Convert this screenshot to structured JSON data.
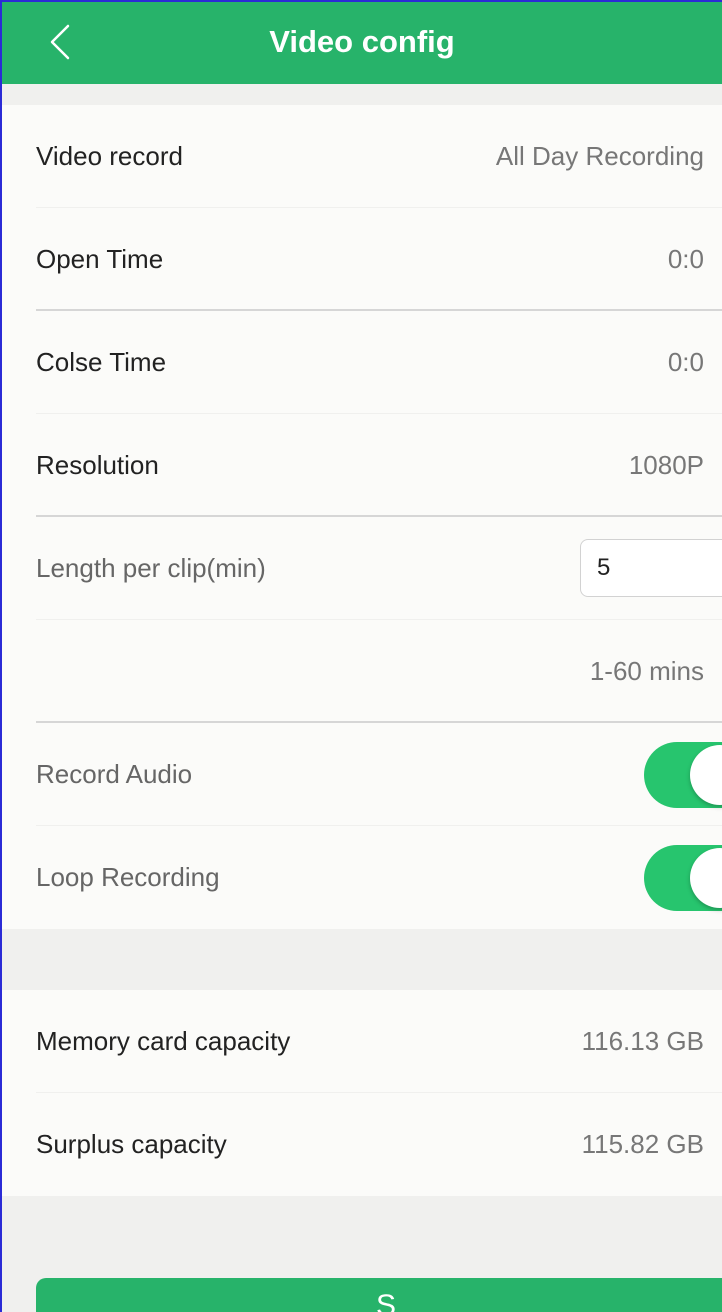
{
  "header": {
    "title": "Video config",
    "back_icon": "chevron-left-icon",
    "color": "#27b36a"
  },
  "settings": {
    "video_record": {
      "label": "Video record",
      "value": "All Day Recording"
    },
    "open_time": {
      "label": "Open Time",
      "value": "0:0"
    },
    "close_time": {
      "label": "Colse Time",
      "value": "0:0"
    },
    "resolution": {
      "label": "Resolution",
      "value": "1080P"
    },
    "clip_length": {
      "label": "Length per clip(min)",
      "value": "5",
      "hint": "1-60 mins"
    },
    "record_audio": {
      "label": "Record Audio",
      "enabled": true
    },
    "loop_recording": {
      "label": "Loop Recording",
      "enabled": true
    }
  },
  "storage": {
    "memory_card": {
      "label": "Memory card capacity",
      "value": "116.13 GB"
    },
    "surplus": {
      "label": "Surplus capacity",
      "value": "115.82 GB"
    }
  },
  "footer": {
    "save_label": "S"
  },
  "colors": {
    "accent": "#27b36a",
    "toggle_on": "#27c56e"
  }
}
